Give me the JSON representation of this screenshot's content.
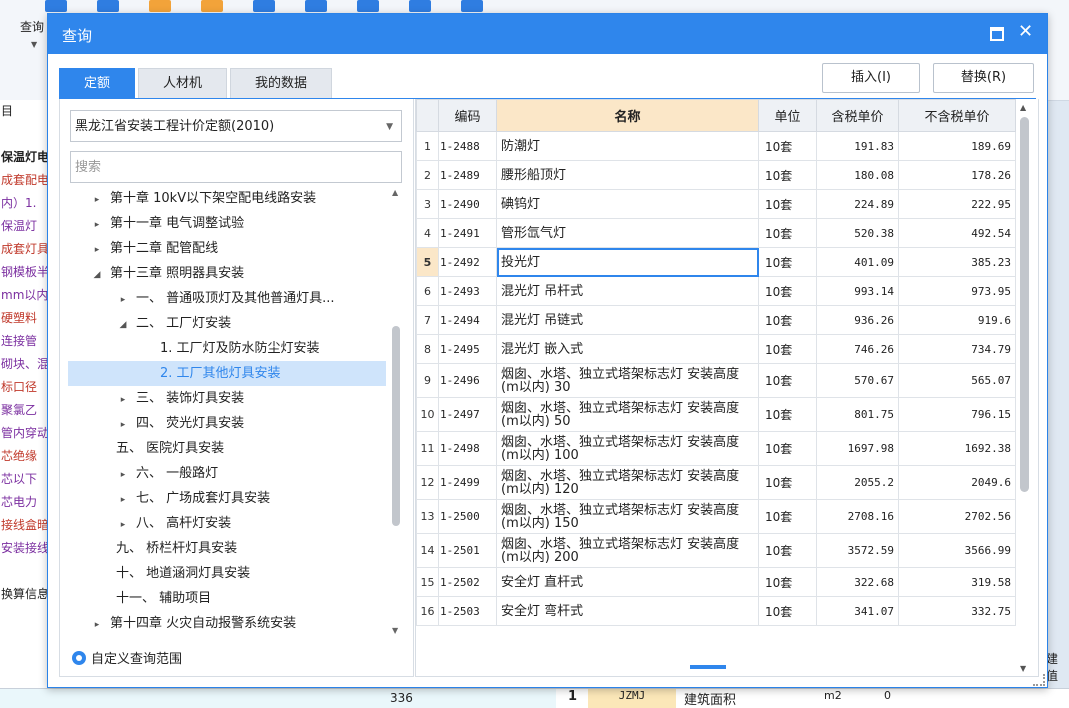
{
  "background": {
    "toolbar_query_label": "查询",
    "left_items": [
      "目",
      "",
      "保温灯电",
      "成套配电",
      "内）1.",
      "保温灯",
      "成套灯具",
      "钢模板半",
      "mm以内)",
      "硬塑料",
      "连接管",
      "砌块、混",
      "标口径",
      "聚氯乙",
      "管内穿动",
      "芯绝缘",
      "芯以下",
      "芯电力",
      "接线盒暗",
      "安装接线",
      "",
      "换算信息"
    ],
    "bottom_number": "336",
    "bottom_row": {
      "index": "1",
      "code": "JZMJ",
      "name": "建筑面积",
      "unit": "m2",
      "value": "0"
    },
    "right_tab_label": "建值"
  },
  "dialog": {
    "title": "查询",
    "tabs": [
      "定额",
      "人材机",
      "我的数据"
    ],
    "active_tab": 0,
    "insert_button": "插入(I)",
    "replace_button": "替换(R)",
    "quota_select": "黑龙江省安装工程计价定额(2010)",
    "search_placeholder": "搜索",
    "tree": [
      {
        "label": "第十章 10kV以下架空配电线路安装",
        "level": 0,
        "caret": "▸"
      },
      {
        "label": "第十一章 电气调整试验",
        "level": 0,
        "caret": "▸"
      },
      {
        "label": "第十二章 配管配线",
        "level": 0,
        "caret": "▸"
      },
      {
        "label": "第十三章 照明器具安装",
        "level": 0,
        "caret": "◢"
      },
      {
        "label": "一、 普通吸顶灯及其他普通灯具...",
        "level": 1,
        "caret": "▸"
      },
      {
        "label": "二、 工厂灯安装",
        "level": 1,
        "caret": "◢"
      },
      {
        "label": "1. 工厂灯及防水防尘灯安装",
        "level": 2,
        "caret": ""
      },
      {
        "label": "2. 工厂其他灯具安装",
        "level": 2,
        "caret": "",
        "selected": true
      },
      {
        "label": "三、 装饰灯具安装",
        "level": 1,
        "caret": "▸"
      },
      {
        "label": "四、 荧光灯具安装",
        "level": 1,
        "caret": "▸"
      },
      {
        "label": "五、 医院灯具安装",
        "level": 1,
        "caret": ""
      },
      {
        "label": "六、 一般路灯",
        "level": 1,
        "caret": "▸"
      },
      {
        "label": "七、 广场成套灯具安装",
        "level": 1,
        "caret": "▸"
      },
      {
        "label": "八、 高杆灯安装",
        "level": 1,
        "caret": "▸"
      },
      {
        "label": "九、 桥栏杆灯具安装",
        "level": 1,
        "caret": ""
      },
      {
        "label": "十、 地道涵洞灯具安装",
        "level": 1,
        "caret": ""
      },
      {
        "label": "十一、 辅助项目",
        "level": 1,
        "caret": ""
      },
      {
        "label": "第十四章 火灾自动报警系统安装",
        "level": 0,
        "caret": "▸"
      }
    ],
    "custom_scope": "自定义查询范围",
    "columns": [
      "",
      "编码",
      "名称",
      "单位",
      "含税单价",
      "不含税单价"
    ],
    "rows": [
      {
        "i": "1",
        "code": "1-2488",
        "name": "防潮灯",
        "unit": "10套",
        "tax": "191.83",
        "notax": "189.69"
      },
      {
        "i": "2",
        "code": "1-2489",
        "name": "腰形船顶灯",
        "unit": "10套",
        "tax": "180.08",
        "notax": "178.26"
      },
      {
        "i": "3",
        "code": "1-2490",
        "name": "碘钨灯",
        "unit": "10套",
        "tax": "224.89",
        "notax": "222.95"
      },
      {
        "i": "4",
        "code": "1-2491",
        "name": "管形氙气灯",
        "unit": "10套",
        "tax": "520.38",
        "notax": "492.54"
      },
      {
        "i": "5",
        "code": "1-2492",
        "name": "投光灯",
        "unit": "10套",
        "tax": "401.09",
        "notax": "385.23",
        "selected": true
      },
      {
        "i": "6",
        "code": "1-2493",
        "name": "混光灯 吊杆式",
        "unit": "10套",
        "tax": "993.14",
        "notax": "973.95"
      },
      {
        "i": "7",
        "code": "1-2494",
        "name": "混光灯 吊链式",
        "unit": "10套",
        "tax": "936.26",
        "notax": "919.6"
      },
      {
        "i": "8",
        "code": "1-2495",
        "name": "混光灯 嵌入式",
        "unit": "10套",
        "tax": "746.26",
        "notax": "734.79"
      },
      {
        "i": "9",
        "code": "1-2496",
        "name": "烟囱、水塔、独立式塔架标志灯 安装高度(m以内) 30",
        "unit": "10套",
        "tax": "570.67",
        "notax": "565.07"
      },
      {
        "i": "10",
        "code": "1-2497",
        "name": "烟囱、水塔、独立式塔架标志灯 安装高度(m以内) 50",
        "unit": "10套",
        "tax": "801.75",
        "notax": "796.15"
      },
      {
        "i": "11",
        "code": "1-2498",
        "name": "烟囱、水塔、独立式塔架标志灯 安装高度(m以内) 100",
        "unit": "10套",
        "tax": "1697.98",
        "notax": "1692.38"
      },
      {
        "i": "12",
        "code": "1-2499",
        "name": "烟囱、水塔、独立式塔架标志灯 安装高度(m以内) 120",
        "unit": "10套",
        "tax": "2055.2",
        "notax": "2049.6"
      },
      {
        "i": "13",
        "code": "1-2500",
        "name": "烟囱、水塔、独立式塔架标志灯 安装高度(m以内) 150",
        "unit": "10套",
        "tax": "2708.16",
        "notax": "2702.56"
      },
      {
        "i": "14",
        "code": "1-2501",
        "name": "烟囱、水塔、独立式塔架标志灯 安装高度(m以内) 200",
        "unit": "10套",
        "tax": "3572.59",
        "notax": "3566.99"
      },
      {
        "i": "15",
        "code": "1-2502",
        "name": "安全灯 直杆式",
        "unit": "10套",
        "tax": "322.68",
        "notax": "319.58"
      },
      {
        "i": "16",
        "code": "1-2503",
        "name": "安全灯 弯杆式",
        "unit": "10套",
        "tax": "341.07",
        "notax": "332.75"
      }
    ]
  }
}
